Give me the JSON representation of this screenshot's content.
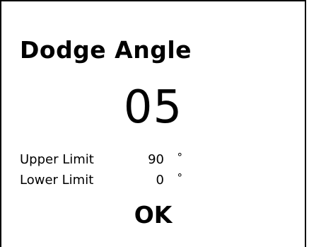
{
  "screen": {
    "title": "Dodge Angle",
    "value": "05",
    "upper_limit": {
      "label": "Upper Limit",
      "value": "90",
      "unit": "°"
    },
    "lower_limit": {
      "label": "Lower Limit",
      "value": "0",
      "unit": "°"
    },
    "ok_label": "OK"
  }
}
